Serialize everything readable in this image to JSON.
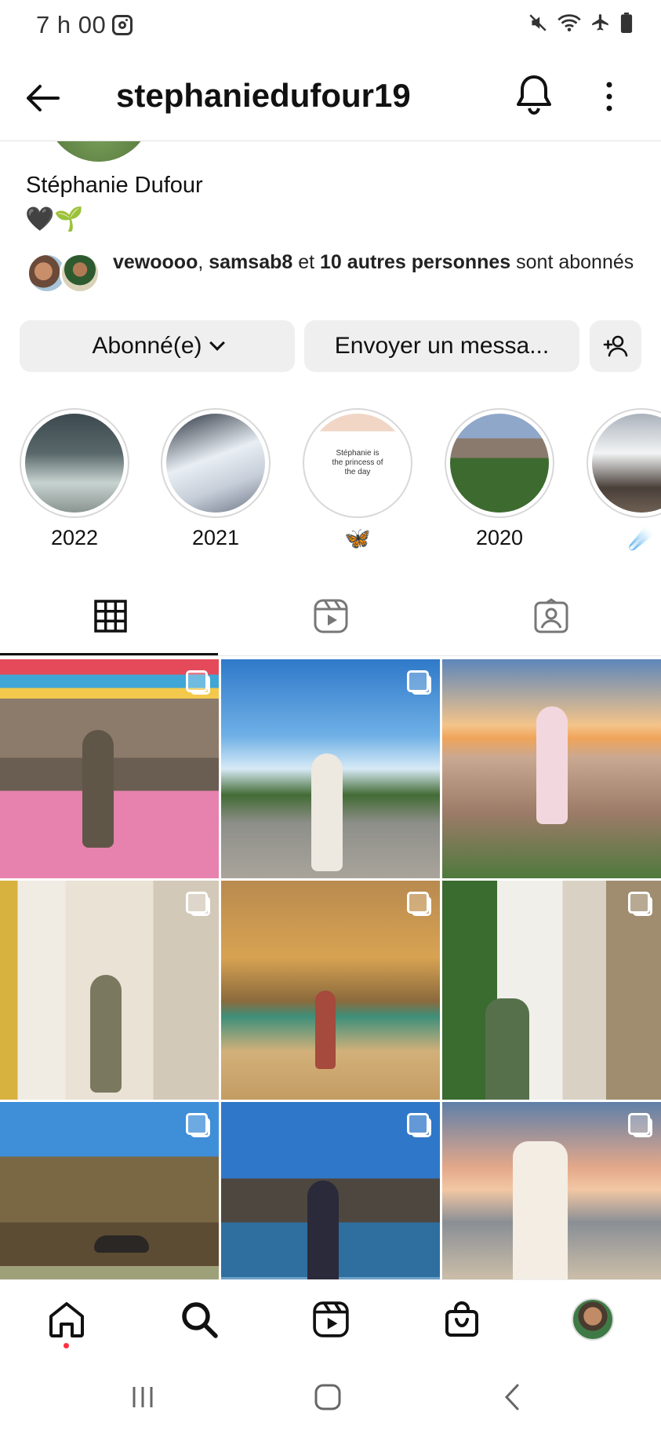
{
  "status_bar": {
    "time": "7 h 00",
    "icons": [
      "instagram-icon",
      "mute-icon",
      "wifi-icon",
      "airplane-icon",
      "battery-icon"
    ]
  },
  "header": {
    "username": "stephaniedufour19",
    "icons": [
      "back-arrow-icon",
      "bell-icon",
      "more-vertical-icon"
    ]
  },
  "profile": {
    "full_name": "Stéphanie Dufour",
    "bio": "🖤🌱",
    "followed_by": {
      "user1": "vewoooo",
      "separator": ", ",
      "user2": "samsab8",
      "conj": " et ",
      "others": "10 autres personnes",
      "suffix": " sont abonnés"
    }
  },
  "actions": {
    "follow_label": "Abonné(e)",
    "message_label": "Envoyer un messa..."
  },
  "highlights": [
    {
      "label": "2022"
    },
    {
      "label": "2021"
    },
    {
      "label": "🦋",
      "card_text": "Stéphanie is the princess of the day"
    },
    {
      "label": "2020"
    },
    {
      "label": "☄️"
    }
  ],
  "tabs": [
    "grid-icon",
    "reels-icon",
    "tagged-icon"
  ],
  "posts_count_visible": 9,
  "bottom_nav": [
    "home-icon",
    "search-icon",
    "reels-icon",
    "shop-icon",
    "profile-avatar"
  ],
  "colors": {
    "text": "#111111",
    "button_bg": "#efefef",
    "notification_dot": "#ff3040"
  }
}
